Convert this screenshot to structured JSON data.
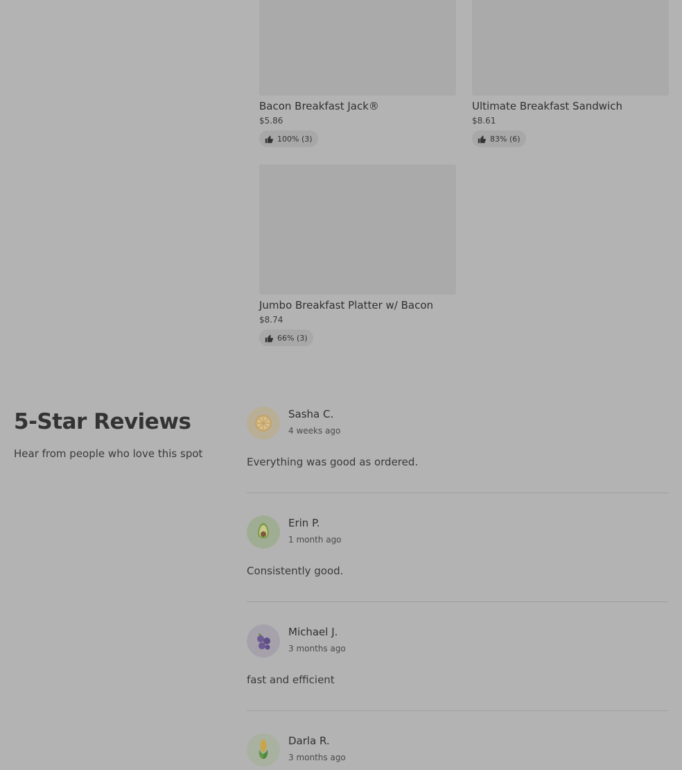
{
  "menu": {
    "items": [
      {
        "name": "Bacon Breakfast Jack®",
        "price": "$5.86",
        "rating": "100% (3)"
      },
      {
        "name": "Ultimate Breakfast Sandwich",
        "price": "$8.61",
        "rating": "83% (6)"
      },
      {
        "name": "Jumbo Breakfast Platter w/ Bacon",
        "price": "$8.74",
        "rating": "66% (3)"
      }
    ]
  },
  "reviews": {
    "title": "5-Star Reviews",
    "subtitle": "Hear from people who love this spot",
    "items": [
      {
        "author": "Sasha C.",
        "time": "4 weeks ago",
        "text": "Everything was good as ordered.",
        "avatar_icon": "lemon-icon"
      },
      {
        "author": "Erin P.",
        "time": "1 month ago",
        "text": "Consistently good.",
        "avatar_icon": "avocado-icon"
      },
      {
        "author": "Michael J.",
        "time": "3 months ago",
        "text": "fast and efficient",
        "avatar_icon": "blueberries-icon"
      },
      {
        "author": "Darla R.",
        "time": "3 months ago",
        "text": "",
        "avatar_icon": "corn-icon"
      }
    ]
  },
  "icons": {
    "rating": "thumbs-up-icon"
  }
}
